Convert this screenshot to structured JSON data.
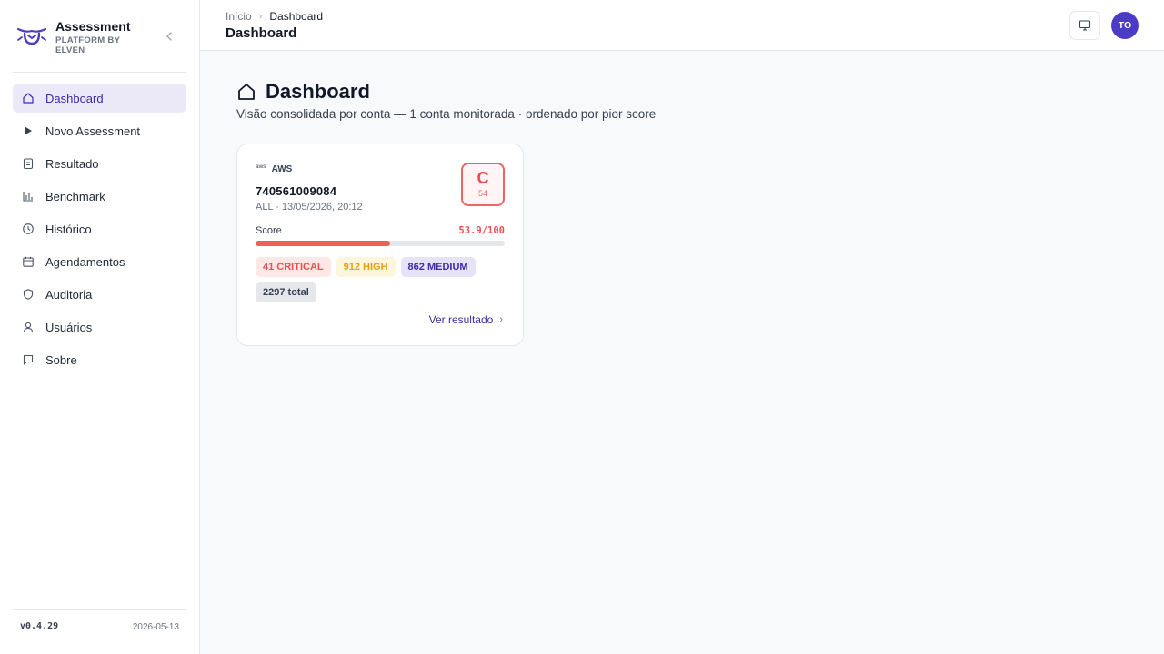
{
  "brand": {
    "title": "Assessment",
    "subtitle": "PLATFORM BY ELVEN"
  },
  "sidebar": {
    "items": [
      {
        "label": "Dashboard",
        "icon": "home-icon",
        "active": true
      },
      {
        "label": "Novo Assessment",
        "icon": "play-icon"
      },
      {
        "label": "Resultado",
        "icon": "clipboard-icon"
      },
      {
        "label": "Benchmark",
        "icon": "bar-chart-icon"
      },
      {
        "label": "Histórico",
        "icon": "clock-icon"
      },
      {
        "label": "Agendamentos",
        "icon": "calendar-icon"
      },
      {
        "label": "Auditoria",
        "icon": "shield-icon"
      },
      {
        "label": "Usuários",
        "icon": "user-icon"
      },
      {
        "label": "Sobre",
        "icon": "message-square-icon"
      }
    ],
    "version": "v0.4.29",
    "date": "2026-05-13"
  },
  "header": {
    "breadcrumb_home": "Início",
    "breadcrumb_current": "Dashboard",
    "title": "Dashboard",
    "avatar_initials": "TO"
  },
  "main": {
    "title": "Dashboard",
    "subtitle": "Visão consolidada por conta — 1 conta monitorada · ordenado por pior score"
  },
  "card": {
    "provider_logo": "aws",
    "provider": "AWS",
    "account_id": "740561009084",
    "meta": "ALL · 13/05/2026, 20:12",
    "grade": "C",
    "grade_score": "54",
    "score_label": "Score",
    "score_text": "53.9/100",
    "score_fraction": 0.539,
    "chips": {
      "critical": "41 CRITICAL",
      "high": "912 HIGH",
      "medium": "862 MEDIUM",
      "total": "2297 total"
    },
    "link": "Ver resultado",
    "colors": {
      "critical": "#e45151",
      "high": "#e3a214",
      "medium": "#3f2aa8",
      "accent": "#4c3bc4"
    }
  }
}
